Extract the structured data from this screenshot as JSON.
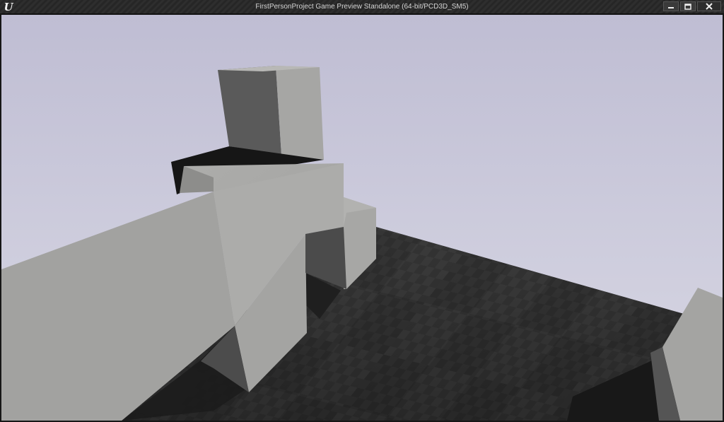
{
  "window": {
    "title": "FirstPersonProject Game Preview Standalone (64-bit/PCD3D_SM5)",
    "logo_text": "U",
    "icons": {
      "logo": "unreal-engine-logo",
      "minimize": "minimize-icon",
      "maximize": "maximize-icon",
      "close": "close-icon"
    }
  },
  "viewport": {
    "scene": "first-person-3d-view",
    "objects": [
      "gray-box-block-tall",
      "gray-box-ramp-large",
      "gray-box-block-small",
      "gray-box-block-right",
      "checkered-floor"
    ]
  },
  "colors": {
    "sky": "#c9c8da",
    "floor": "#3a3a3a",
    "block": "#a7a7a5",
    "shadow": "#1e1e1e"
  }
}
